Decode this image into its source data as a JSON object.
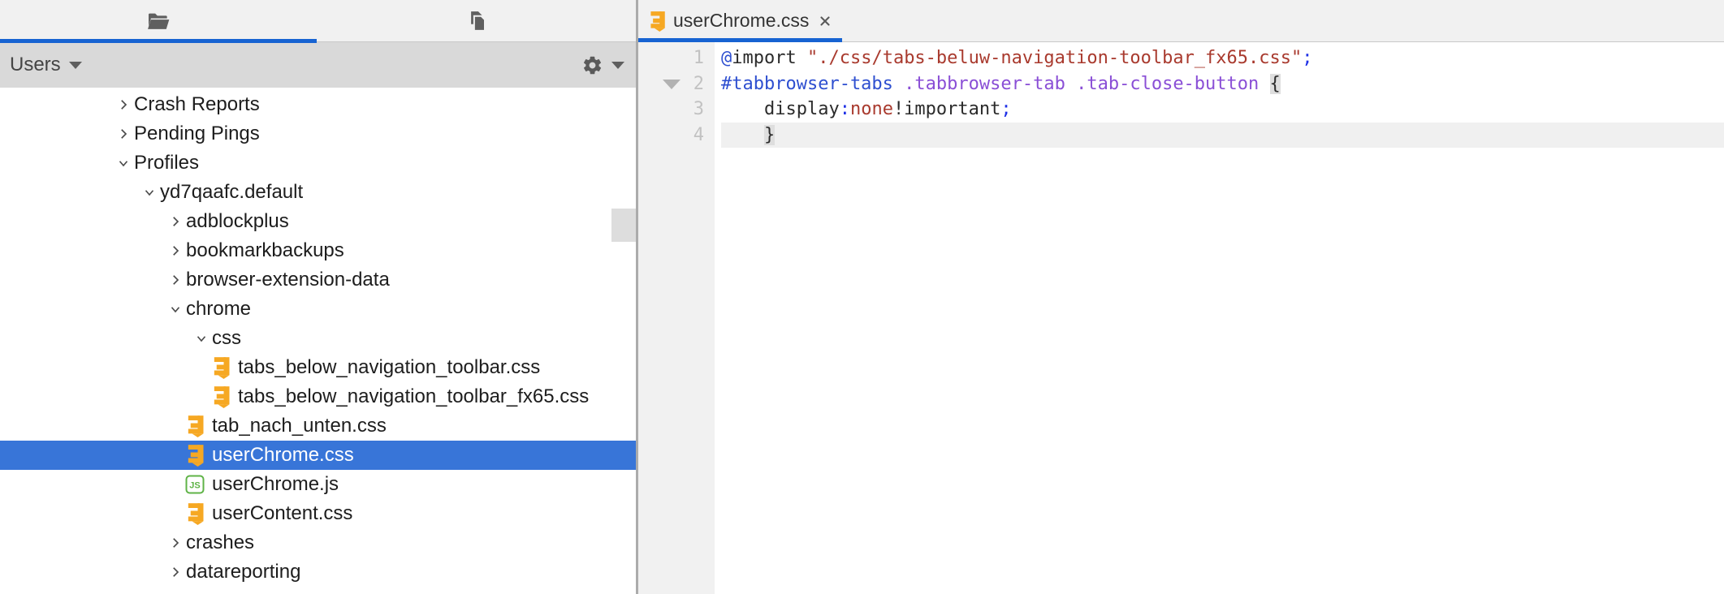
{
  "colors": {
    "accent_blue": "#1763D2",
    "selection_blue": "#3875D8",
    "panel_tab_bg": "#F1F1F1",
    "toolbar_bg": "#D9D9D9",
    "divider_gray": "#ABABAB",
    "gutter_bg": "#F1F1F1",
    "current_line_bg": "#F0F0F0",
    "css_icon_yellow": "#F6A823",
    "js_icon_green": "#5FB347",
    "token_blue": "#2E4FD0",
    "token_punct_blue": "#1E30E6",
    "token_string_red": "#A93A2E",
    "token_class_purple": "#8A4FD6",
    "token_text": "#2B2B2B"
  },
  "left_panel": {
    "tabs": [
      {
        "icon": "open-folder-icon",
        "active": true
      },
      {
        "icon": "documents-icon",
        "active": false
      }
    ],
    "toolbar": {
      "scope_label": "Users",
      "scope_caret_icon": "dropdown-caret-icon",
      "gear_icon": "gear-icon",
      "gear_caret_icon": "dropdown-caret-icon"
    },
    "tree": {
      "items": [
        {
          "label": "Crash Reports",
          "kind": "folder",
          "state": "collapsed",
          "level": 0
        },
        {
          "label": "Pending Pings",
          "kind": "folder",
          "state": "collapsed",
          "level": 0
        },
        {
          "label": "Profiles",
          "kind": "folder",
          "state": "expanded",
          "level": 0
        },
        {
          "label": "yd7qaafc.default",
          "kind": "folder",
          "state": "expanded",
          "level": 1
        },
        {
          "label": "adblockplus",
          "kind": "folder",
          "state": "collapsed",
          "level": 2
        },
        {
          "label": "bookmarkbackups",
          "kind": "folder",
          "state": "collapsed",
          "level": 2
        },
        {
          "label": "browser-extension-data",
          "kind": "folder",
          "state": "collapsed",
          "level": 2
        },
        {
          "label": "chrome",
          "kind": "folder",
          "state": "expanded",
          "level": 2
        },
        {
          "label": "css",
          "kind": "folder",
          "state": "expanded",
          "level": 3
        },
        {
          "label": "tabs_below_navigation_toolbar.css",
          "kind": "css-file",
          "level": 4
        },
        {
          "label": "tabs_below_navigation_toolbar_fx65.css",
          "kind": "css-file",
          "level": 4
        },
        {
          "label": "tab_nach_unten.css",
          "kind": "css-file",
          "level": 3
        },
        {
          "label": "userChrome.css",
          "kind": "css-file",
          "level": 3,
          "selected": true
        },
        {
          "label": "userChrome.js",
          "kind": "js-file",
          "level": 3
        },
        {
          "label": "userContent.css",
          "kind": "css-file",
          "level": 3
        },
        {
          "label": "crashes",
          "kind": "folder",
          "state": "collapsed",
          "level": 2
        },
        {
          "label": "datareporting",
          "kind": "folder",
          "state": "collapsed",
          "level": 2
        }
      ]
    }
  },
  "editor": {
    "tab": {
      "label": "userChrome.css",
      "icon": "css-file-icon",
      "close_icon": "close-icon",
      "active": true
    },
    "gutter": {
      "numbers": [
        "1",
        "2",
        "3",
        "4"
      ],
      "fold_arrow_line": 2
    },
    "current_line": 4,
    "code_lines": [
      {
        "tokens": [
          {
            "text": "@",
            "cls": "at"
          },
          {
            "text": "import",
            "cls": "kw"
          },
          {
            "text": " ",
            "cls": "plain"
          },
          {
            "text": "\"./css/tabs-beluw-navigation-toolbar_fx65.css\"",
            "cls": "str"
          },
          {
            "text": ";",
            "cls": "punc"
          }
        ]
      },
      {
        "tokens": [
          {
            "text": "#tabbrowser-tabs",
            "cls": "id"
          },
          {
            "text": " ",
            "cls": "plain"
          },
          {
            "text": ".tabbrowser-tab",
            "cls": "cls"
          },
          {
            "text": " ",
            "cls": "plain"
          },
          {
            "text": ".tab-close-button",
            "cls": "cls"
          },
          {
            "text": " ",
            "cls": "plain"
          },
          {
            "text": "{",
            "cls": "brace"
          }
        ]
      },
      {
        "tokens": [
          {
            "text": "    ",
            "cls": "plain"
          },
          {
            "text": "display",
            "cls": "kw"
          },
          {
            "text": ":",
            "cls": "punc"
          },
          {
            "text": "none",
            "cls": "val"
          },
          {
            "text": "!important",
            "cls": "kw"
          },
          {
            "text": ";",
            "cls": "punc"
          }
        ]
      },
      {
        "tokens": [
          {
            "text": "    ",
            "cls": "plain"
          },
          {
            "text": "}",
            "cls": "brace"
          }
        ]
      }
    ]
  }
}
